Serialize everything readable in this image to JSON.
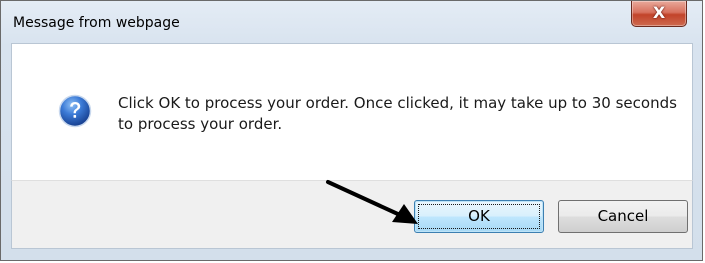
{
  "window": {
    "title": "Message from webpage",
    "close_glyph": "X"
  },
  "message": {
    "icon": "question-icon",
    "text": "Click OK to process your order. Once clicked, it may take up to 30 seconds to process your order."
  },
  "buttons": {
    "ok_label": "OK",
    "cancel_label": "Cancel"
  },
  "annotation": {
    "arrow_color": "#000000",
    "arrow_points_to": "OK"
  },
  "colors": {
    "close_button": "#c7432b",
    "ok_button_focus": "#3c7fb1",
    "question_icon": "#2a63b8"
  }
}
